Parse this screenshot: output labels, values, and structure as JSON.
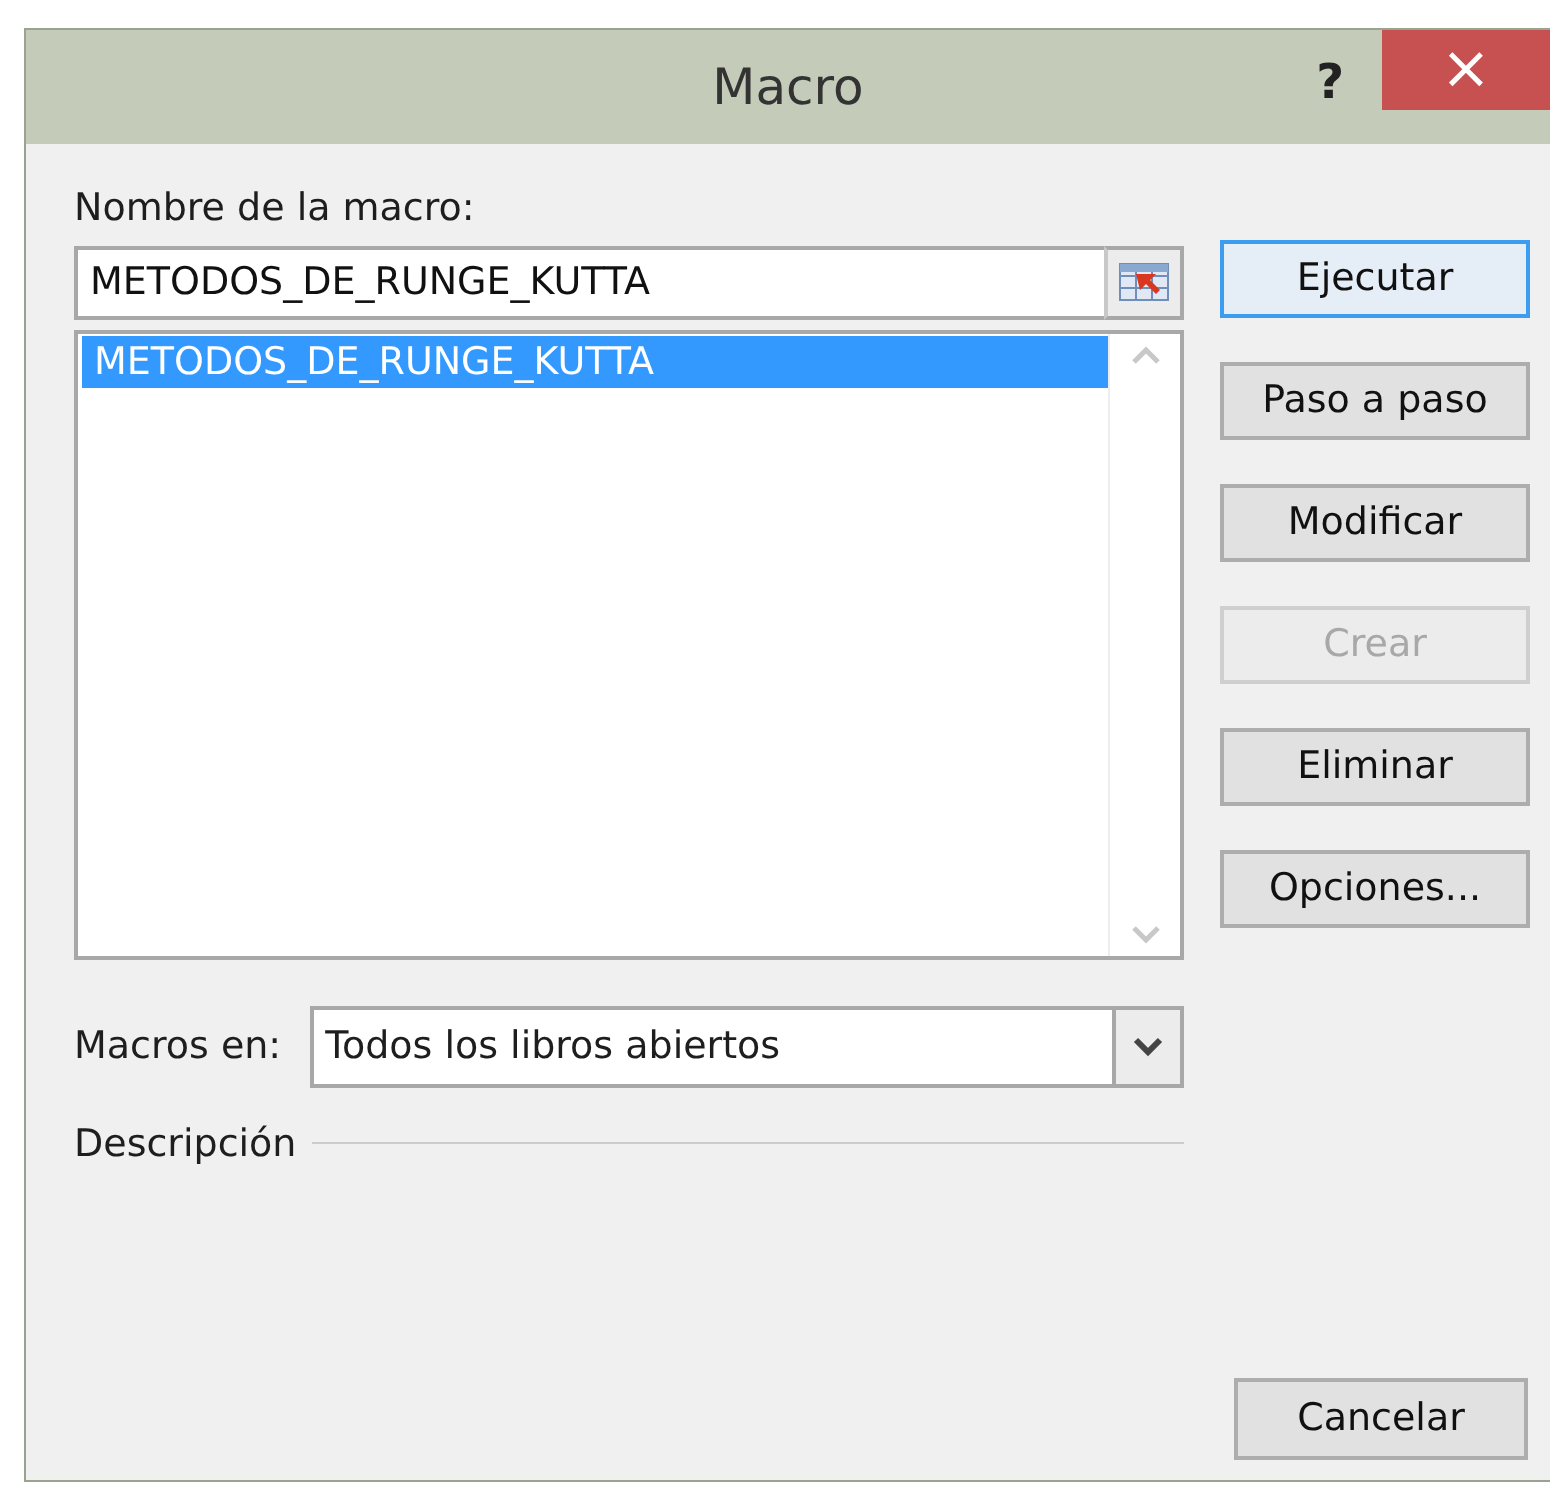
{
  "window": {
    "title": "Macro",
    "help": "?",
    "close": "×"
  },
  "macro_name": {
    "label": "Nombre de la macro:",
    "value": "METODOS_DE_RUNGE_KUTTA"
  },
  "macro_list": [
    {
      "name": "METODOS_DE_RUNGE_KUTTA",
      "selected": true
    }
  ],
  "buttons": [
    {
      "label": "Ejecutar",
      "default": true,
      "disabled": false
    },
    {
      "label": "Paso a paso",
      "default": false,
      "disabled": false
    },
    {
      "label": "Modificar",
      "default": false,
      "disabled": false
    },
    {
      "label": "Crear",
      "default": false,
      "disabled": true
    },
    {
      "label": "Eliminar",
      "default": false,
      "disabled": false
    },
    {
      "label": "Opciones...",
      "default": false,
      "disabled": false
    }
  ],
  "macros_in": {
    "label": "Macros en:",
    "value": "Todos los libros abiertos"
  },
  "description": {
    "label": "Descripción"
  },
  "cancel": "Cancelar"
}
